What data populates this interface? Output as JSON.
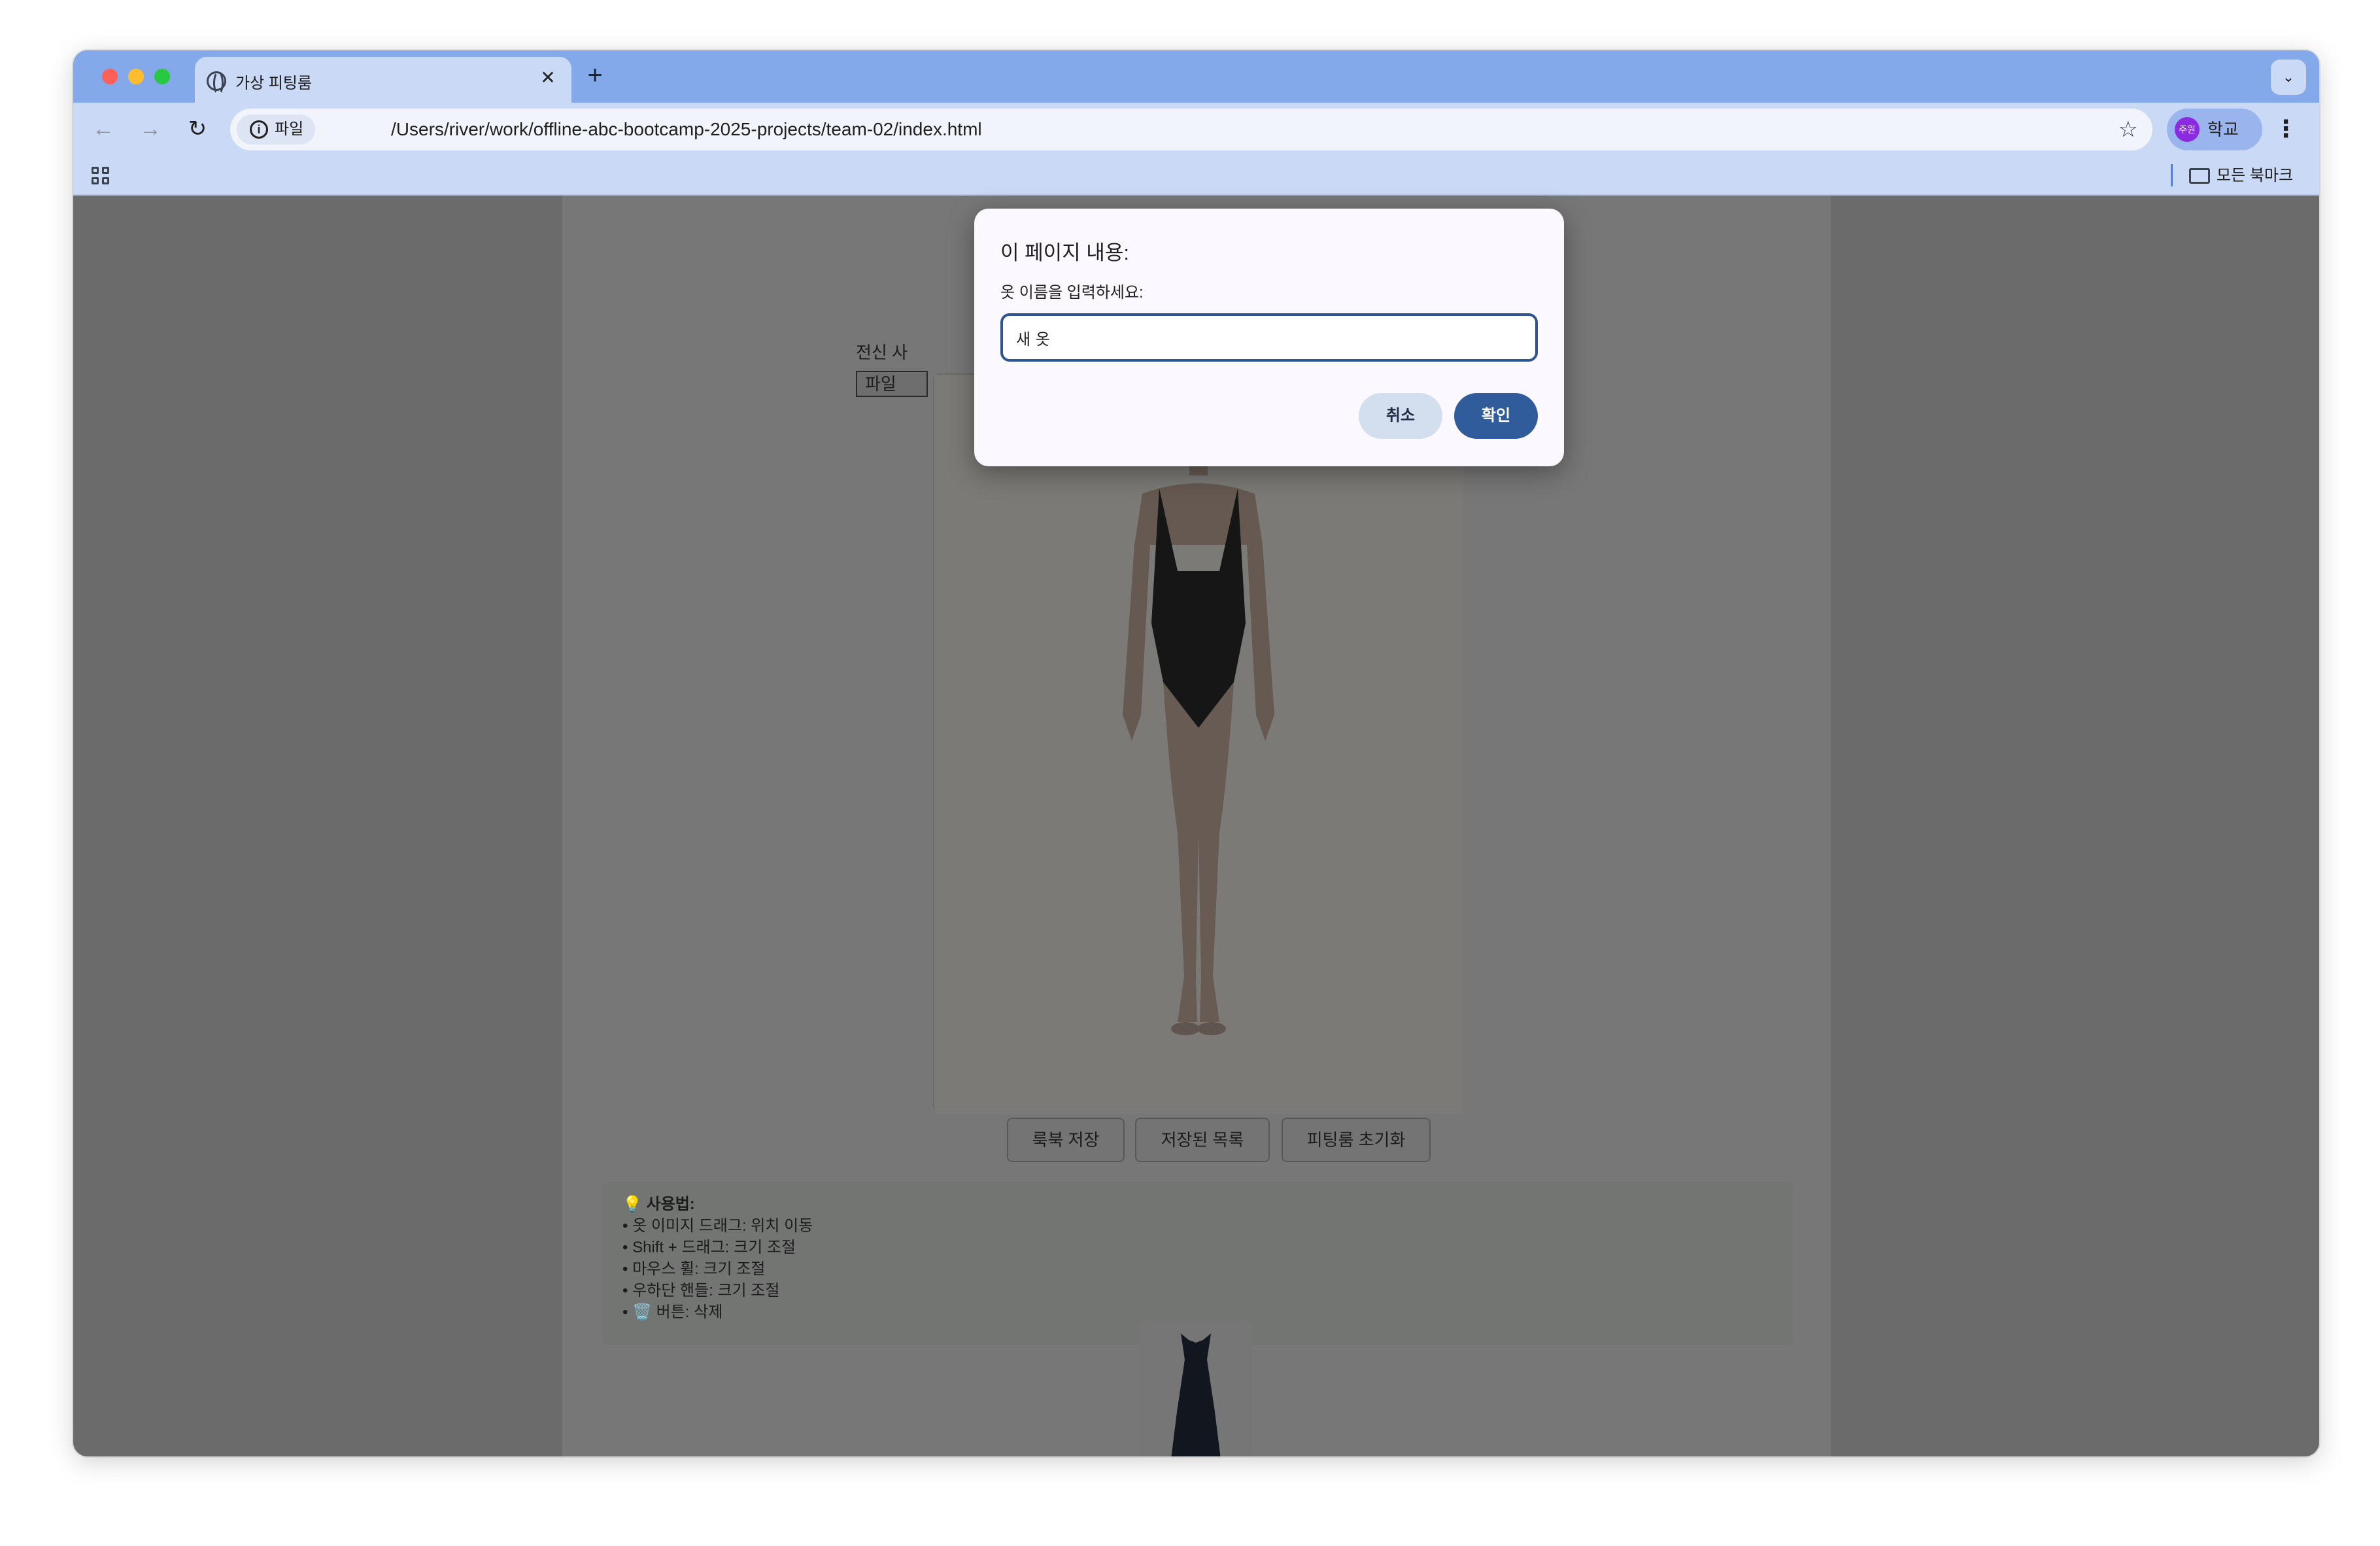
{
  "browser": {
    "tab_title": "가상 피팅룸",
    "tab_close": "✕",
    "new_tab": "+",
    "chip_label": "파일",
    "url": "/Users/river/work/offline-abc-bootcamp-2025-projects/team-02/index.html",
    "profile_badge": "주원",
    "profile_name": "학교",
    "bookmarks_folder": "모든 북마크"
  },
  "page": {
    "upload_label_partial": "전신 사",
    "file_button": "파일",
    "buttons": [
      "룩북 저장",
      "저장된 목록",
      "피팅룸 초기화"
    ],
    "usage": {
      "title": "💡 사용법:",
      "lines": [
        "• 옷 이미지 드래그: 위치 이동",
        "• Shift + 드래그: 크기 조절",
        "• 마우스 휠: 크기 조절",
        "• 우하단 핸들: 크기 조절",
        "• 🗑️ 버튼: 삭제"
      ]
    }
  },
  "dialog": {
    "title": "이 페이지 내용:",
    "message": "옷 이름을 입력하세요:",
    "input_value": "새 옷",
    "cancel_label": "취소",
    "ok_label": "확인"
  }
}
